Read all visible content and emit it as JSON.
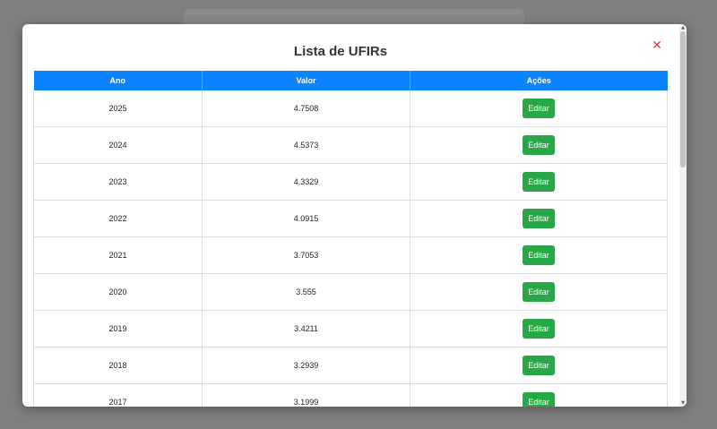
{
  "modal": {
    "title": "Lista de UFIRs",
    "close_icon": "close-icon",
    "close_glyph": "✕"
  },
  "table": {
    "headers": [
      "Ano",
      "Valor",
      "Ações"
    ],
    "rows": [
      {
        "ano": "2025",
        "valor": "4.7508",
        "acao": "Editar"
      },
      {
        "ano": "2024",
        "valor": "4.5373",
        "acao": "Editar"
      },
      {
        "ano": "2023",
        "valor": "4.3329",
        "acao": "Editar"
      },
      {
        "ano": "2022",
        "valor": "4.0915",
        "acao": "Editar"
      },
      {
        "ano": "2021",
        "valor": "3.7053",
        "acao": "Editar"
      },
      {
        "ano": "2020",
        "valor": "3.555",
        "acao": "Editar"
      },
      {
        "ano": "2019",
        "valor": "3.4211",
        "acao": "Editar"
      },
      {
        "ano": "2018",
        "valor": "3.2939",
        "acao": "Editar"
      },
      {
        "ano": "2017",
        "valor": "3.1999",
        "acao": "Editar"
      }
    ]
  },
  "colors": {
    "header_bg": "#0d84ff",
    "edit_button": "#27a745",
    "close_icon": "#e53935",
    "overlay": "#7f7f7f"
  },
  "scrollbar": {
    "up_glyph": "▲",
    "down_glyph": "▼"
  }
}
